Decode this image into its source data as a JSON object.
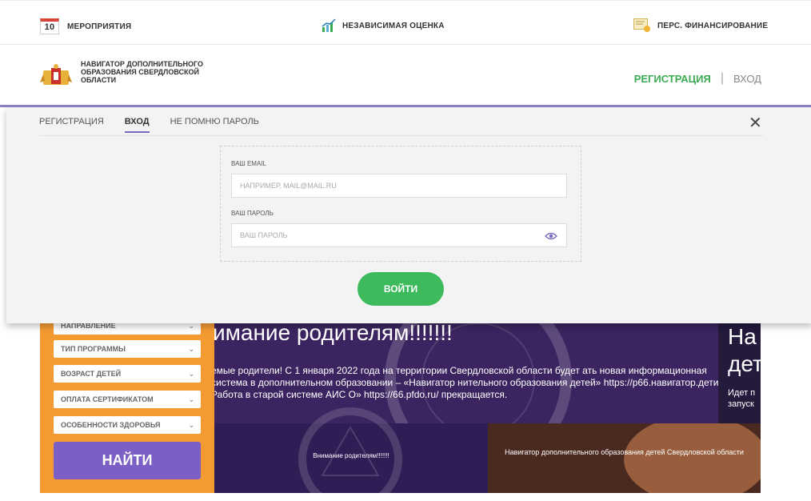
{
  "topbar": {
    "calendar_day": "10",
    "events": "МЕРОПРИЯТИЯ",
    "assessment": "НЕЗАВИСИМАЯ ОЦЕНКА",
    "funding": "ПЕРС. ФИНАНСИРОВАНИЕ"
  },
  "header": {
    "logo_text": "НАВИГАТОР ДОПОЛНИТЕЛЬНОГО ОБРАЗОВАНИЯ СВЕРДЛОВСКОЙ ОБЛАСТИ",
    "register": "РЕГИСТРАЦИЯ",
    "separator": "|",
    "login": "ВХОД"
  },
  "modal": {
    "tabs": [
      {
        "label": "РЕГИСТРАЦИЯ"
      },
      {
        "label": "ВХОД"
      },
      {
        "label": "НЕ ПОМНЮ ПАРОЛЬ"
      }
    ],
    "close": "✕",
    "email_label": "ВАШ EMAIL",
    "email_placeholder": "НАПРИМЕР, MAIL@MAIL.RU",
    "password_label": "ВАШ ПАРОЛЬ",
    "password_placeholder": "ВАШ ПАРОЛЬ",
    "submit": "ВОЙТИ"
  },
  "filters": {
    "items": [
      {
        "label": "НАПРАВЛЕНИЕ"
      },
      {
        "label": "ТИП ПРОГРАММЫ"
      },
      {
        "label": "ВОЗРАСТ ДЕТЕЙ"
      },
      {
        "label": "ОПЛАТА СЕРТИФИКАТОМ"
      },
      {
        "label": "ОСОБЕННОСТИ ЗДОРОВЬЯ"
      }
    ],
    "find": "НАЙТИ"
  },
  "banners": {
    "main_title": "имание родителям!!!!!!!",
    "main_text": "емые родители! С 1 января 2022 года на территории Свердловской области будет ать новая информационная система в дополнительном образовании – «Навигатор нительного образования детей» https://p66.навигатор.дети. Работа в старой системе АИС О» https://66.pfdo.ru/ прекращается.",
    "right_big_1": "На",
    "right_big_2": "дет",
    "right_small_1": "Идет п",
    "right_small_2": "запуск",
    "card1_caption": "Внимание родителям!!!!!!!",
    "card2_caption": "Навигатор дополнительного образования детей Свердловской области"
  },
  "colors": {
    "accent_green": "#3bab52",
    "accent_purple": "#7b67c0",
    "filter_orange": "#f39a32",
    "find_button": "#7b5fc5"
  }
}
